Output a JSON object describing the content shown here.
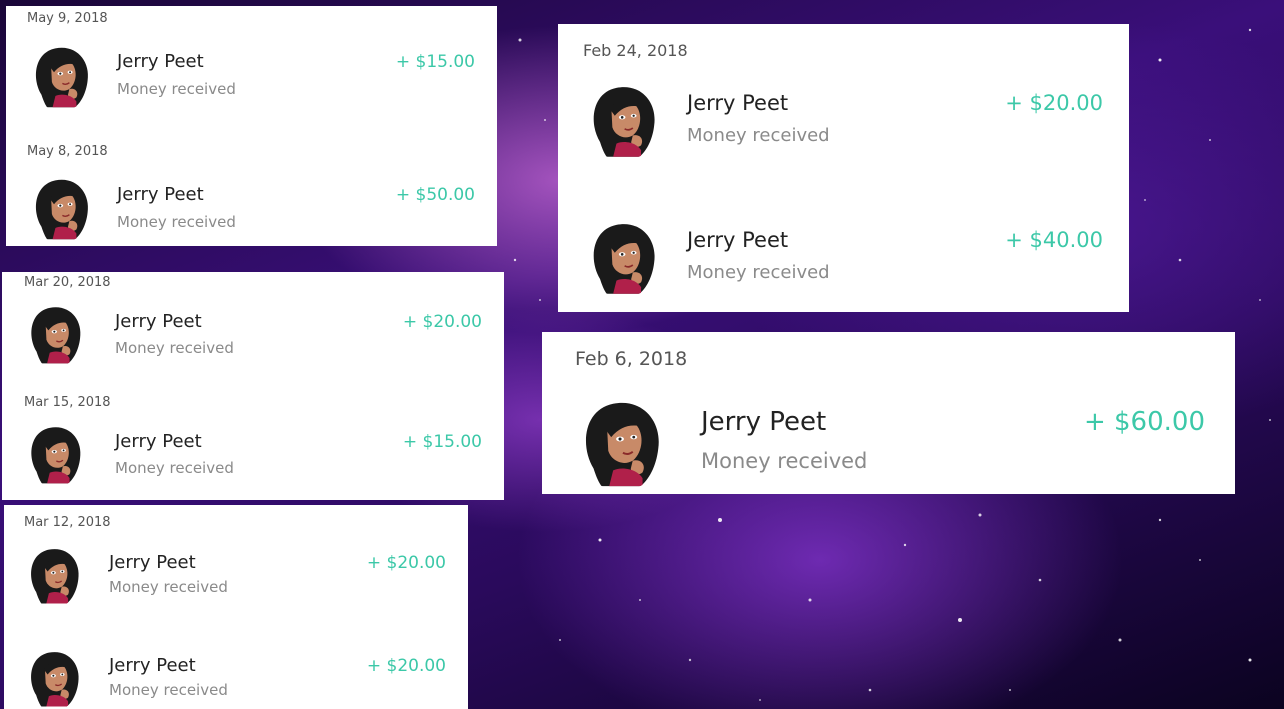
{
  "colors": {
    "amount": "#3cc8a8",
    "background": "#3a0f7a"
  },
  "avatar_icon": "profile-avatar-icon",
  "cards": [
    {
      "entries": [
        {
          "date": "May 9, 2018",
          "name": "Jerry Peet",
          "status": "Money received",
          "amount": "+ $15.00"
        },
        {
          "date": "May 8, 2018",
          "name": "Jerry Peet",
          "status": "Money received",
          "amount": "+ $50.00"
        }
      ]
    },
    {
      "entries": [
        {
          "date": "Mar 20, 2018",
          "name": "Jerry Peet",
          "status": "Money received",
          "amount": "+ $20.00"
        },
        {
          "date": "Mar 15, 2018",
          "name": "Jerry Peet",
          "status": "Money received",
          "amount": "+ $15.00"
        }
      ]
    },
    {
      "entries": [
        {
          "date": "Mar 12, 2018",
          "name": "Jerry Peet",
          "status": "Money received",
          "amount": "+ $20.00"
        },
        {
          "date": "",
          "name": "Jerry Peet",
          "status": "Money received",
          "amount": "+ $20.00"
        }
      ]
    },
    {
      "entries": [
        {
          "date": "Feb 24, 2018",
          "name": "Jerry Peet",
          "status": "Money received",
          "amount": "+ $20.00"
        },
        {
          "date": "",
          "name": "Jerry Peet",
          "status": "Money received",
          "amount": "+ $40.00"
        }
      ]
    },
    {
      "entries": [
        {
          "date": "Feb 6, 2018",
          "name": "Jerry Peet",
          "status": "Money received",
          "amount": "+ $60.00"
        }
      ]
    }
  ]
}
